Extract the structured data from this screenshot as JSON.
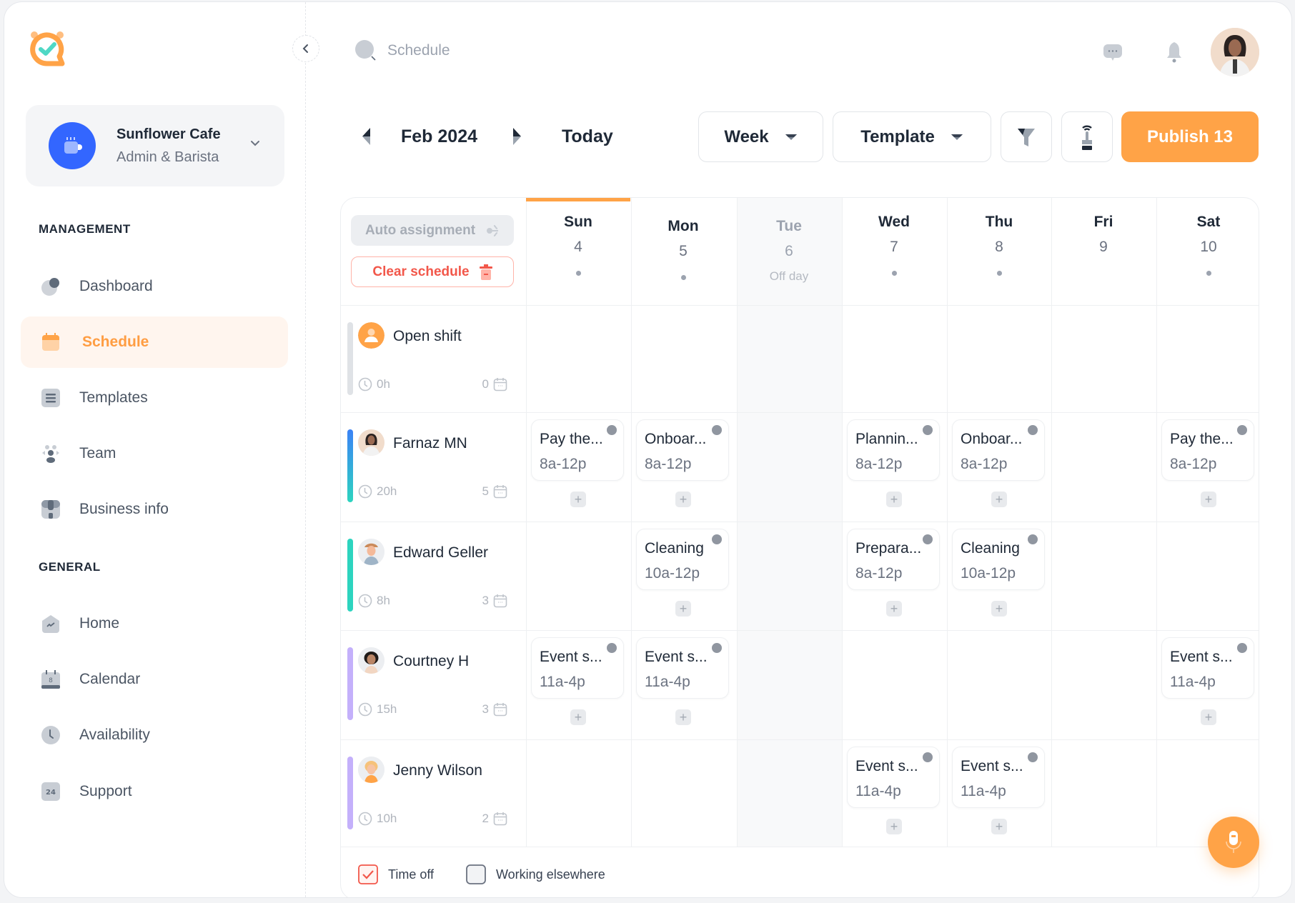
{
  "app": {
    "brand_colors": {
      "accent": "#ffa347",
      "danger": "#f2574a",
      "business_avatar": "#3366ff"
    }
  },
  "business": {
    "name": "Sunflower Cafe",
    "role": "Admin & Barista",
    "icon": "coffee-cup-icon"
  },
  "sidebar": {
    "sections": [
      {
        "label": "MANAGEMENT",
        "items": [
          {
            "label": "Dashboard",
            "icon": "pie-chart-icon",
            "active": false
          },
          {
            "label": "Schedule",
            "icon": "calendar-icon",
            "active": true
          },
          {
            "label": "Templates",
            "icon": "list-icon",
            "active": false
          },
          {
            "label": "Team",
            "icon": "team-icon",
            "active": false
          },
          {
            "label": "Business info",
            "icon": "shop-icon",
            "active": false
          }
        ]
      },
      {
        "label": "GENERAL",
        "items": [
          {
            "label": "Home",
            "icon": "home-icon",
            "active": false
          },
          {
            "label": "Calendar",
            "icon": "calendar-date-icon",
            "active": false,
            "badge": "8"
          },
          {
            "label": "Availability",
            "icon": "clock-icon",
            "active": false
          },
          {
            "label": "Support",
            "icon": "support-24-icon",
            "active": false,
            "badge": "24"
          }
        ]
      }
    ]
  },
  "header": {
    "search_placeholder": "Schedule"
  },
  "toolbar": {
    "month": "Feb 2024",
    "today_label": "Today",
    "view_select": "Week",
    "template_select": "Template",
    "publish_label": "Publish 13"
  },
  "grid": {
    "auto_assignment_label": "Auto assignment",
    "clear_schedule_label": "Clear schedule",
    "days": [
      {
        "name": "Sun",
        "num": "4",
        "today": true,
        "off": false,
        "sub": ""
      },
      {
        "name": "Mon",
        "num": "5",
        "today": false,
        "off": false,
        "sub": ""
      },
      {
        "name": "Tue",
        "num": "6",
        "today": false,
        "off": true,
        "sub": "Off day"
      },
      {
        "name": "Wed",
        "num": "7",
        "today": false,
        "off": false,
        "sub": ""
      },
      {
        "name": "Thu",
        "num": "8",
        "today": false,
        "off": false,
        "sub": ""
      },
      {
        "name": "Fri",
        "num": "9",
        "today": false,
        "off": false,
        "sub": ""
      },
      {
        "name": "Sat",
        "num": "10",
        "today": false,
        "off": false,
        "sub": ""
      }
    ],
    "employees": [
      {
        "name": "Open shift",
        "hours": "0h",
        "shift_count": "0",
        "color": "#dfe2e6",
        "avatar": "open-shift",
        "shifts": []
      },
      {
        "name": "Farnaz MN",
        "hours": "20h",
        "shift_count": "5",
        "color": "gradient-blue-teal",
        "avatar": "farnaz",
        "shifts": [
          {
            "day": 0,
            "title": "Pay the...",
            "time": "8a-12p"
          },
          {
            "day": 1,
            "title": "Onboar...",
            "time": "8a-12p"
          },
          {
            "day": 3,
            "title": "Plannin...",
            "time": "8a-12p"
          },
          {
            "day": 4,
            "title": "Onboar...",
            "time": "8a-12p"
          },
          {
            "day": 6,
            "title": "Pay the...",
            "time": "8a-12p"
          }
        ]
      },
      {
        "name": "Edward Geller",
        "hours": "8h",
        "shift_count": "3",
        "color": "#2dd4bf",
        "avatar": "edward",
        "shifts": [
          {
            "day": 1,
            "title": "Cleaning",
            "time": "10a-12p"
          },
          {
            "day": 3,
            "title": "Prepara...",
            "time": "8a-12p"
          },
          {
            "day": 4,
            "title": "Cleaning",
            "time": "10a-12p"
          }
        ]
      },
      {
        "name": "Courtney H",
        "hours": "15h",
        "shift_count": "3",
        "color": "#c4b0fb",
        "avatar": "courtney",
        "shifts": [
          {
            "day": 0,
            "title": "Event s...",
            "time": "11a-4p"
          },
          {
            "day": 1,
            "title": "Event s...",
            "time": "11a-4p"
          },
          {
            "day": 6,
            "title": "Event s...",
            "time": "11a-4p"
          }
        ]
      },
      {
        "name": "Jenny Wilson",
        "hours": "10h",
        "shift_count": "2",
        "color": "#c4b0fb",
        "avatar": "jenny",
        "shifts": [
          {
            "day": 3,
            "title": "Event s...",
            "time": "11a-4p"
          },
          {
            "day": 4,
            "title": "Event s...",
            "time": "11a-4p"
          }
        ]
      }
    ]
  },
  "legend": [
    {
      "label": "Time off",
      "icon": "time-off-check-icon"
    },
    {
      "label": "Working elsewhere",
      "icon": "working-elsewhere-icon"
    }
  ]
}
